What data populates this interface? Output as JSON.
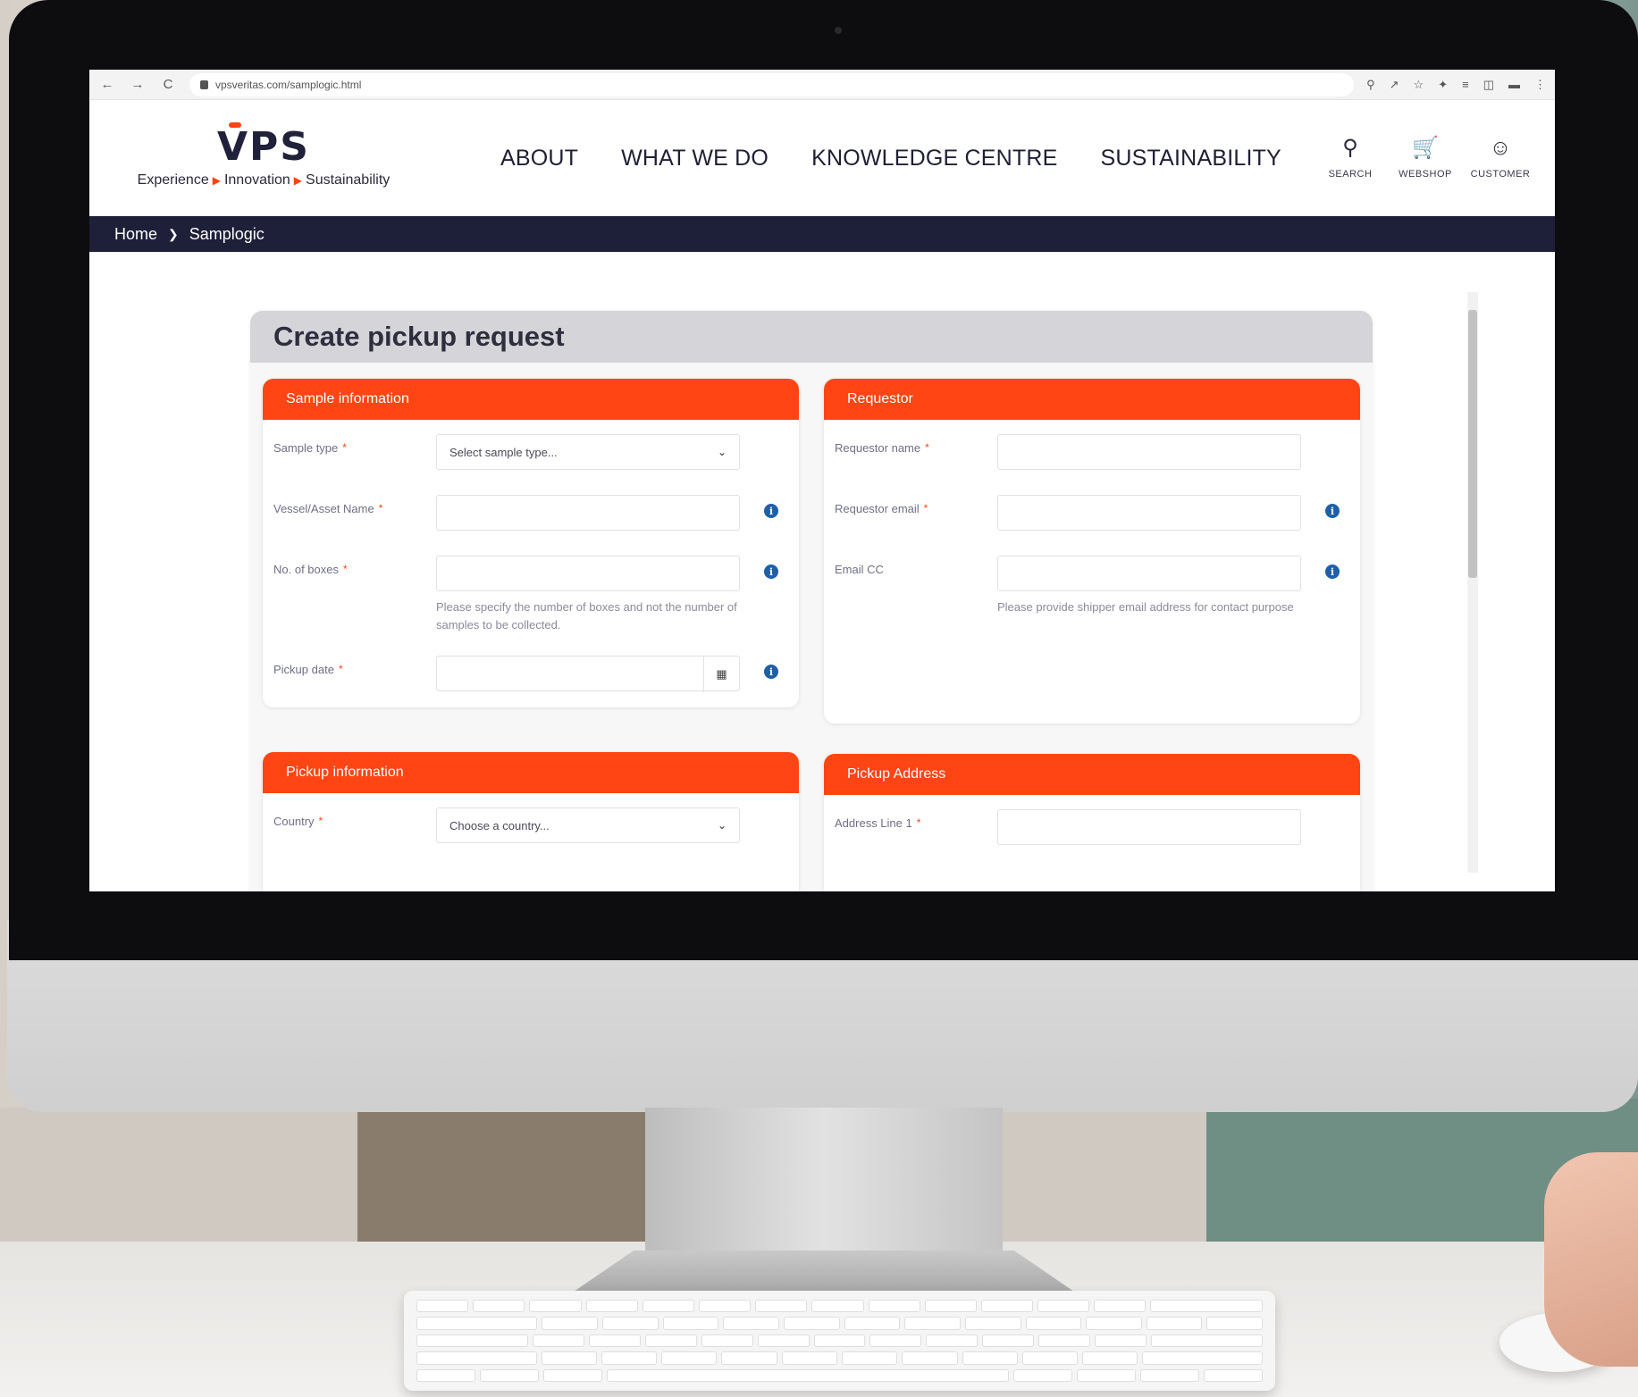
{
  "browser": {
    "url": "vpsveritas.com/samplogic.html",
    "nav_back": "←",
    "nav_forward": "→",
    "nav_reload": "C",
    "action_icons": [
      "zoom-icon",
      "share-icon",
      "star-icon",
      "extensions-icon",
      "reading-list-icon",
      "sidepanel-icon",
      "profile-icon",
      "menu-icon"
    ]
  },
  "site": {
    "logo_text": "VPS",
    "tagline": [
      "Experience",
      "Innovation",
      "Sustainability"
    ],
    "nav": [
      "ABOUT",
      "WHAT WE DO",
      "KNOWLEDGE CENTRE",
      "SUSTAINABILITY"
    ],
    "utility": [
      {
        "label": "SEARCH",
        "icon": "search-icon"
      },
      {
        "label": "WEBSHOP",
        "icon": "cart-icon"
      },
      {
        "label": "CUSTOMER",
        "icon": "user-icon"
      }
    ],
    "brand_accent": "#ff4514",
    "brand_dark": "#1e1f38"
  },
  "breadcrumb": [
    "Home",
    "Samplogic"
  ],
  "form": {
    "title": "Create pickup request",
    "sample_info": {
      "heading": "Sample information",
      "sample_type_label": "Sample type",
      "sample_type_value": "Select sample type...",
      "vessel_label": "Vessel/Asset Name",
      "boxes_label": "No. of boxes",
      "boxes_help": "Please specify the number of boxes and not the number of samples to be collected.",
      "pickup_date_label": "Pickup date"
    },
    "requestor": {
      "heading": "Requestor",
      "name_label": "Requestor name",
      "email_label": "Requestor email",
      "cc_label": "Email CC",
      "cc_help": "Please provide shipper email address for contact purpose"
    },
    "pickup_info": {
      "heading": "Pickup information",
      "country_label": "Country",
      "country_value": "Choose a country..."
    },
    "pickup_address": {
      "heading": "Pickup Address",
      "address1_label": "Address Line 1"
    },
    "required_mark": "*"
  }
}
